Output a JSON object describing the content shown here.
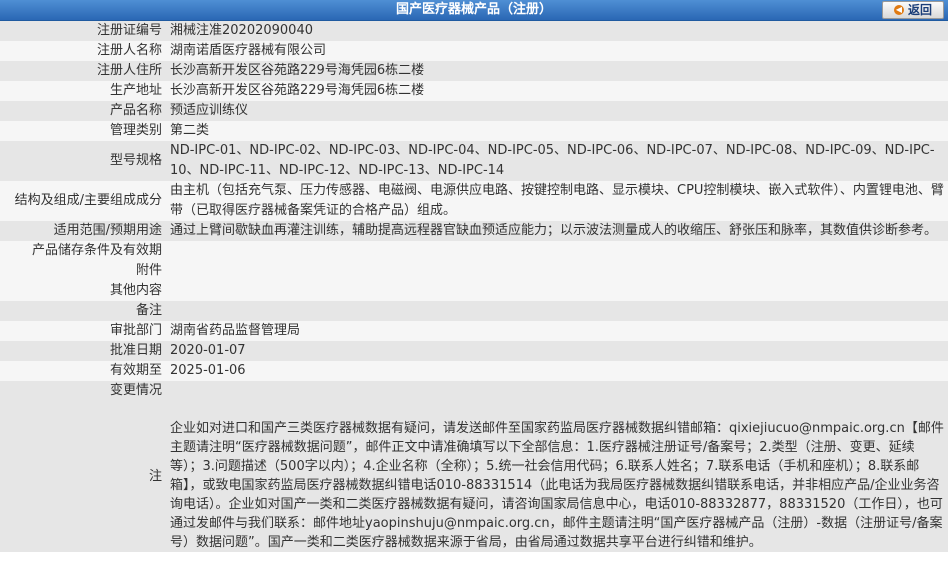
{
  "header": {
    "title": "国产医疗器械产品（注册）",
    "back_label": "返回"
  },
  "rows": [
    {
      "label": "注册证编号",
      "value": "湘械注准20202090040"
    },
    {
      "label": "注册人名称",
      "value": "湖南诺盾医疗器械有限公司"
    },
    {
      "label": "注册人住所",
      "value": "长沙高新开发区谷苑路229号海凭园6栋二楼"
    },
    {
      "label": "生产地址",
      "value": "长沙高新开发区谷苑路229号海凭园6栋二楼"
    },
    {
      "label": "产品名称",
      "value": "预适应训练仪"
    },
    {
      "label": "管理类别",
      "value": "第二类"
    },
    {
      "label": "型号规格",
      "value": "ND-IPC-01、ND-IPC-02、ND-IPC-03、ND-IPC-04、ND-IPC-05、ND-IPC-06、ND-IPC-07、ND-IPC-08、ND-IPC-09、ND-IPC-10、ND-IPC-11、ND-IPC-12、ND-IPC-13、ND-IPC-14"
    },
    {
      "label": "结构及组成/主要组成成分",
      "value": "由主机（包括充气泵、压力传感器、电磁阀、电源供应电路、按键控制电路、显示模块、CPU控制模块、嵌入式软件）、内置锂电池、臂带（已取得医疗器械备案凭证的合格产品）组成。"
    },
    {
      "label": "适用范围/预期用途",
      "value": "通过上臂间歇缺血再灌注训练，辅助提高远程器官缺血预适应能力；以示波法测量成人的收缩压、舒张压和脉率，其数值供诊断参考。"
    },
    {
      "label": "产品储存条件及有效期",
      "value": ""
    },
    {
      "label": "附件",
      "value": ""
    },
    {
      "label": "其他内容",
      "value": ""
    },
    {
      "label": "备注",
      "value": ""
    },
    {
      "label": "审批部门",
      "value": "湖南省药品监督管理局"
    },
    {
      "label": "批准日期",
      "value": "2020-01-07"
    },
    {
      "label": "有效期至",
      "value": "2025-01-06"
    },
    {
      "label": "变更情况",
      "value": ""
    }
  ],
  "note": {
    "label": "注",
    "text": "企业如对进口和国产三类医疗器械数据有疑问，请发送邮件至国家药监局医疗器械数据纠错邮箱：qixiejiucuo@nmpaic.org.cn【邮件主题请注明“医疗器械数据问题”，邮件正文中请准确填写以下全部信息：1.医疗器械注册证号/备案号；2.类型（注册、变更、延续等）；3.问题描述（500字以内）；4.企业名称（全称）；5.统一社会信用代码；6.联系人姓名；7.联系电话（手机和座机）；8.联系邮箱】，或致电国家药监局医疗器械数据纠错电话010-88331514（此电话为我局医疗器械数据纠错联系电话，并非相应产品/企业业务咨询电话）。企业如对国产一类和二类医疗器械数据有疑问，请咨询国家局信息中心，电话010-88332877，88331520（工作日），也可通过发邮件与我们联系：邮件地址yaopinshuju@nmpaic.org.cn，邮件主题请注明“国产医疗器械产品（注册）-数据（注册证号/备案号）数据问题”。国产一类和二类医疗器械数据来源于省局，由省局通过数据共享平台进行纠错和维护。"
  }
}
